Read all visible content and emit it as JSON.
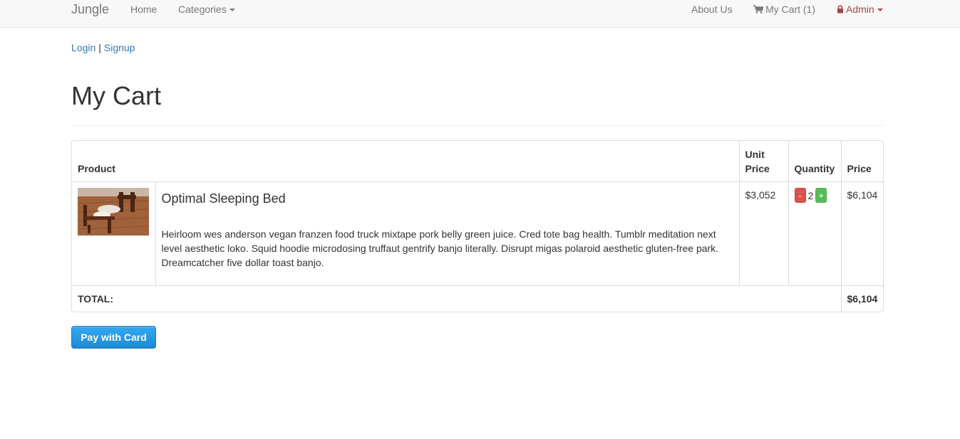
{
  "navbar": {
    "brand": "Jungle",
    "home": "Home",
    "categories": "Categories",
    "about": "About Us",
    "cart": "My Cart (1)",
    "admin": "Admin"
  },
  "auth": {
    "login": "Login",
    "separator": "|",
    "signup": "Signup"
  },
  "page_title": "My Cart",
  "table": {
    "headers": {
      "product": "Product",
      "unit_price": "Unit Price",
      "quantity": "Quantity",
      "price": "Price"
    },
    "rows": [
      {
        "image_icon": "bed-photo",
        "name": "Optimal Sleeping Bed",
        "description": "Heirloom wes anderson vegan franzen food truck mixtape pork belly green juice. Cred tote bag health. Tumblr meditation next level aesthetic loko. Squid hoodie microdosing truffaut gentrify banjo literally. Disrupt migas polaroid aesthetic gluten-free park. Dreamcatcher five dollar toast banjo.",
        "unit_price": "$3,052",
        "quantity": "2",
        "minus": "-",
        "plus": "+",
        "price": "$6,104"
      }
    ],
    "total_label": "TOTAL:",
    "total_value": "$6,104"
  },
  "pay_button": "Pay with Card",
  "colors": {
    "link": "#337ab7",
    "admin": "#a94442",
    "minus": "#d9534f",
    "plus": "#5cb85c",
    "pay": "#1b8ad4"
  }
}
